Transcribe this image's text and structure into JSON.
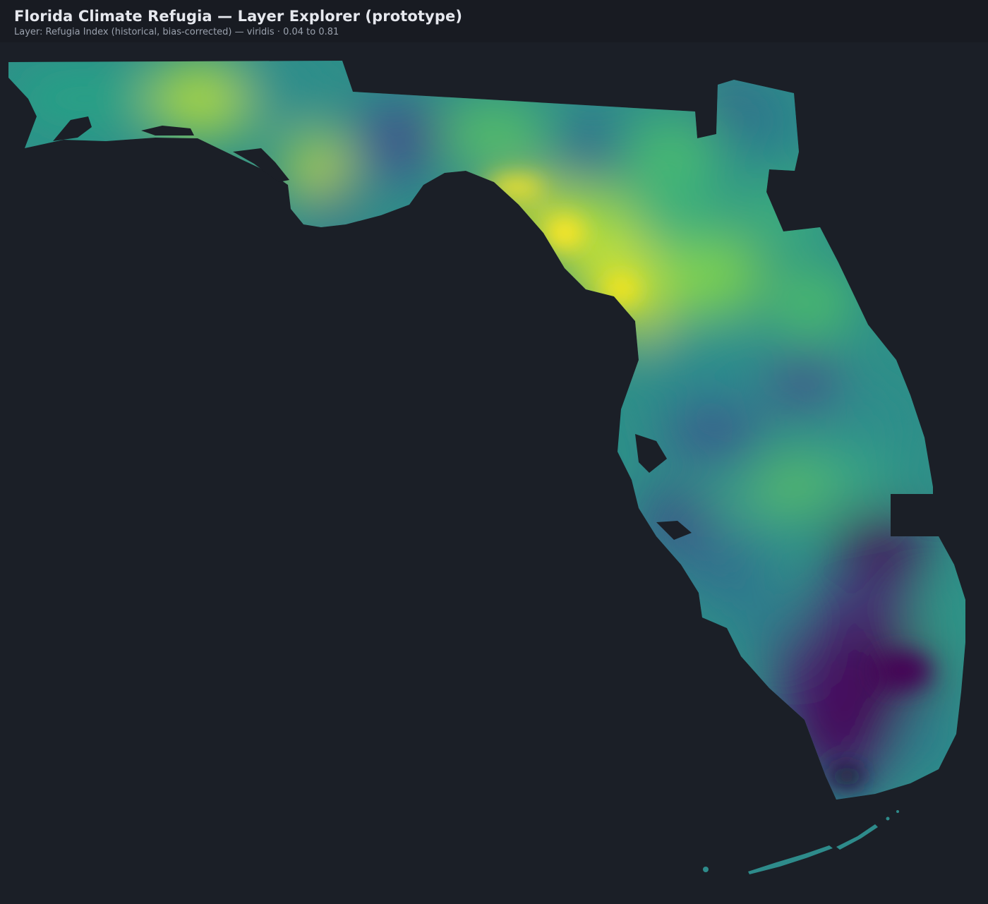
{
  "header": {
    "title": "Florida Climate Refugia — Layer Explorer (prototype)",
    "subtitle": "Layer: Refugia Index (historical, bias-corrected) — viridis · 0.04 to 0.81"
  },
  "layer": {
    "colormap": "viridis",
    "value_min": 0.04,
    "value_max": 0.81,
    "palette": [
      "#440154",
      "#46327e",
      "#365c8d",
      "#277f8e",
      "#1fa187",
      "#4ac16d",
      "#a0da39",
      "#fde725"
    ]
  },
  "map": {
    "background": "#1b1f27"
  }
}
